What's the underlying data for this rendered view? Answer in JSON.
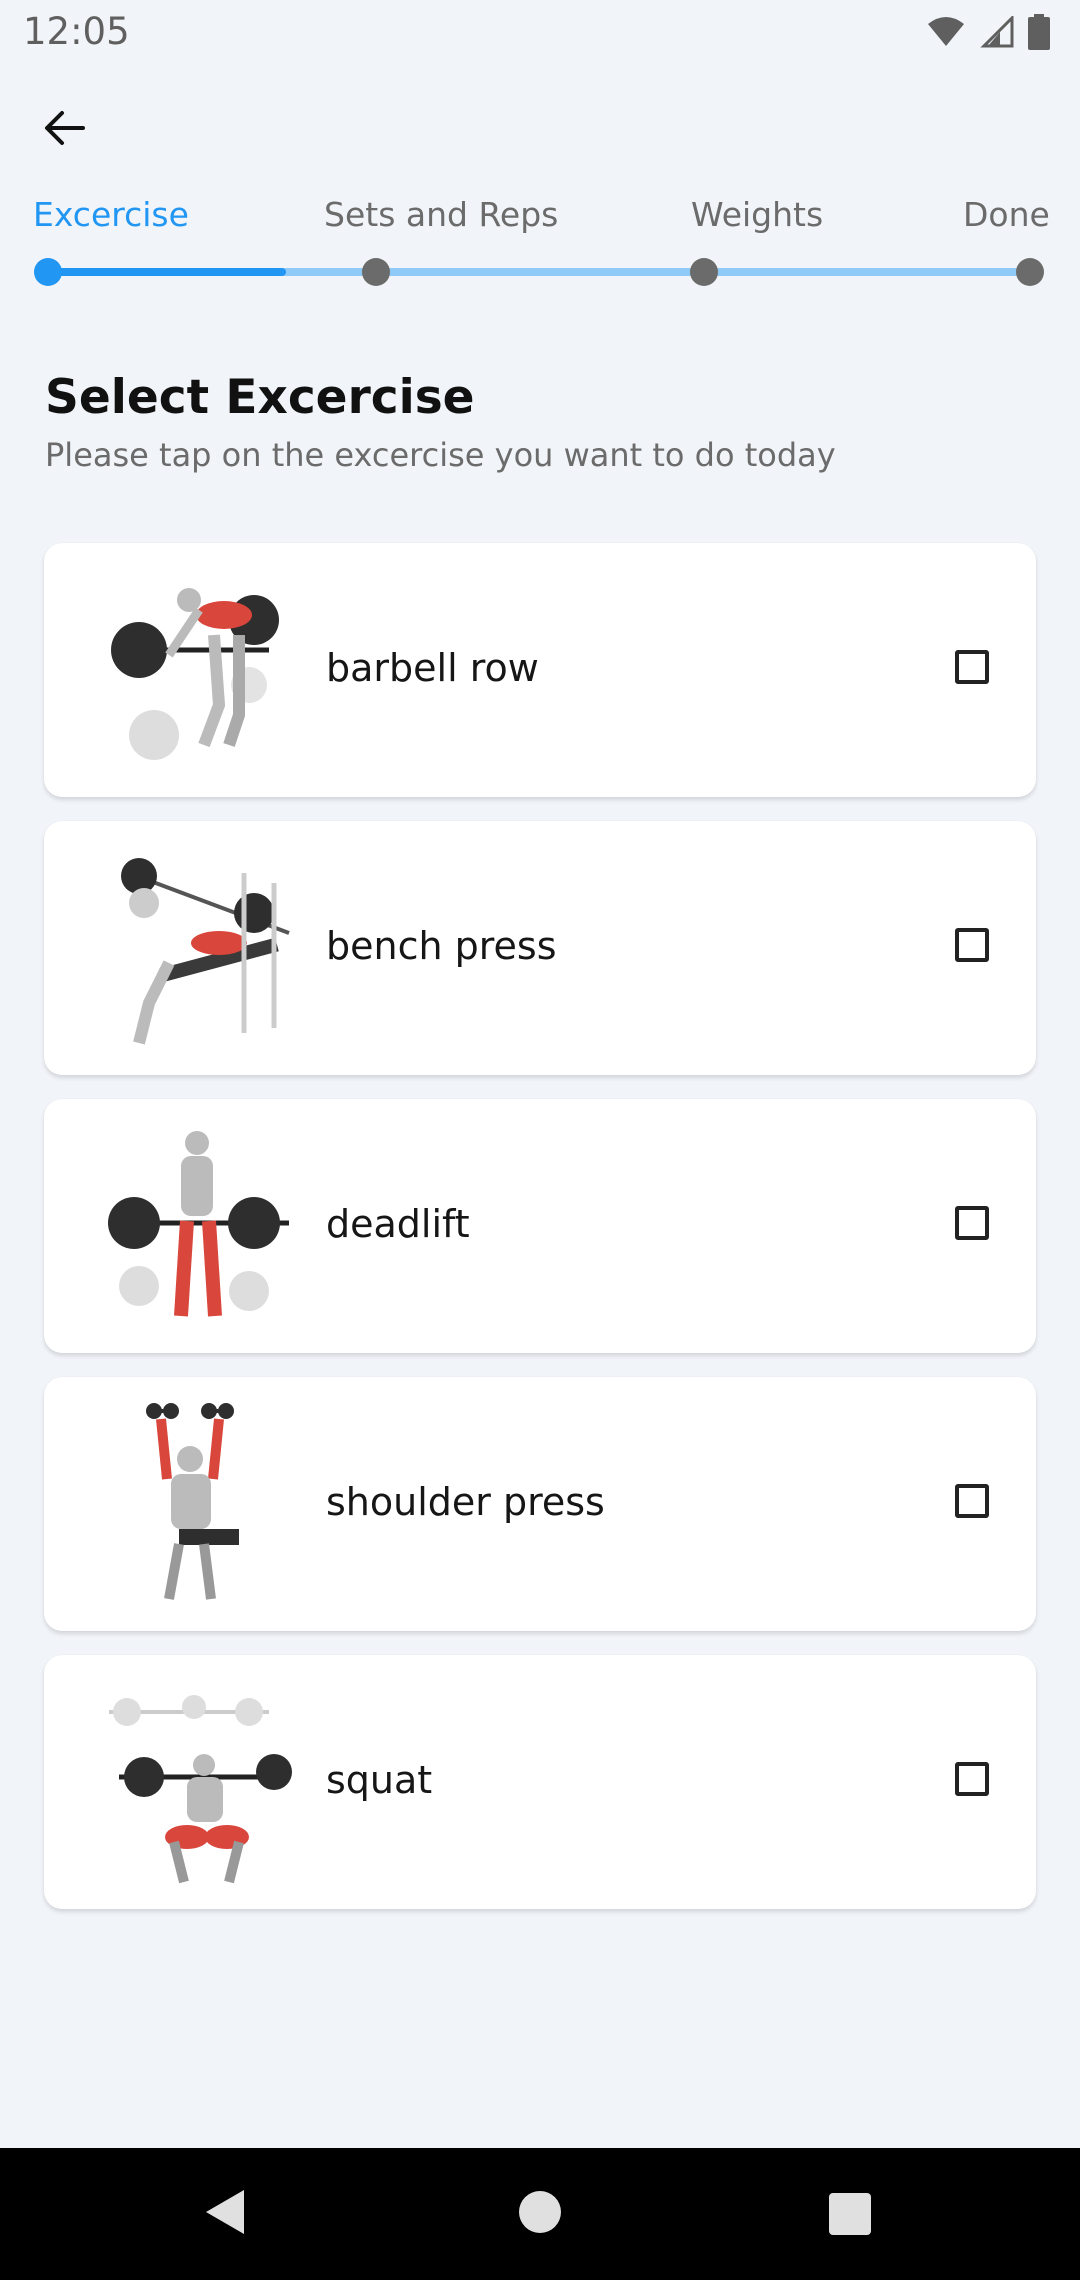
{
  "status_bar": {
    "time": "12:05",
    "icons": [
      "wifi-icon",
      "cell-signal-icon",
      "battery-icon"
    ]
  },
  "header": {
    "back_icon": "arrow-left-icon"
  },
  "stepper": {
    "steps": [
      {
        "label": "Excercise",
        "active": true
      },
      {
        "label": "Sets and Reps",
        "active": false
      },
      {
        "label": "Weights",
        "active": false
      },
      {
        "label": "Done",
        "active": false
      }
    ],
    "progress": 0.25,
    "colors": {
      "active": "#2196f3",
      "track": "#90caf9",
      "inactive": "#6b6b6b"
    }
  },
  "main": {
    "title": "Select Excercise",
    "subtitle": "Please tap on the excercise you want to do today"
  },
  "exercises": [
    {
      "name": "barbell row",
      "image": "barbell-row-illustration",
      "checked": false
    },
    {
      "name": "bench press",
      "image": "bench-press-illustration",
      "checked": false
    },
    {
      "name": "deadlift",
      "image": "deadlift-illustration",
      "checked": false
    },
    {
      "name": "shoulder press",
      "image": "shoulder-press-illustration",
      "checked": false
    },
    {
      "name": "squat",
      "image": "squat-illustration",
      "checked": false
    }
  ],
  "nav_bar": {
    "icons": [
      "nav-back-icon",
      "nav-home-icon",
      "nav-recents-icon"
    ]
  }
}
